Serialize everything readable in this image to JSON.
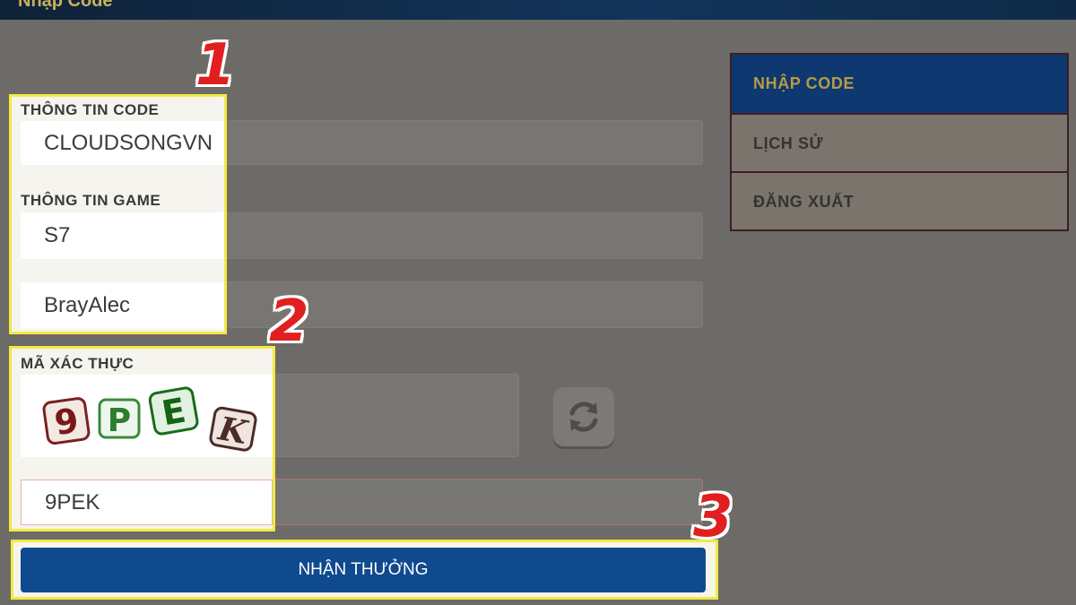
{
  "header": {
    "title": "Nhập Code"
  },
  "form": {
    "code_label": "THÔNG TIN CODE",
    "code_value": "CLOUDSONGVN",
    "game_label": "THÔNG TIN GAME",
    "server_value": "S7",
    "character_value": "BrayAlec",
    "captcha_label": "MÃ XÁC THỰC",
    "captcha_chars": [
      "9",
      "P",
      "E",
      "K"
    ],
    "captcha_input_value": "9PEK",
    "submit_label": "NHẬN THƯỞNG"
  },
  "steps": [
    "1",
    "2",
    "3"
  ],
  "menu": {
    "items": [
      {
        "label": "NHẬP CODE",
        "active": true
      },
      {
        "label": "LỊCH SỬ",
        "active": false
      },
      {
        "label": "ĐĂNG XUẤT",
        "active": false
      }
    ]
  },
  "icons": {
    "refresh": "refresh-icon"
  },
  "colors": {
    "highlight": "#f2ea43",
    "step_number": "#e11f1f",
    "primary_button": "#0f4a8f",
    "active_menu": "#0d3870"
  }
}
